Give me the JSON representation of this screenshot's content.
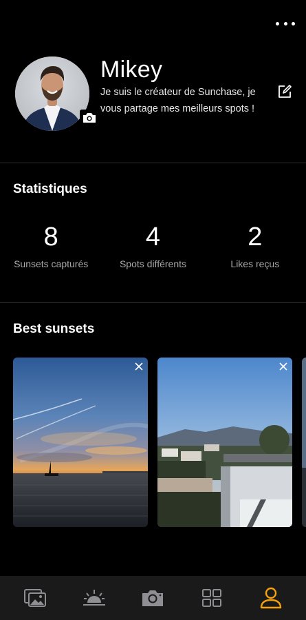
{
  "header": {
    "more_icon": "more-horizontal-icon"
  },
  "profile": {
    "name": "Mikey",
    "bio": "Je suis le créateur de Sunchase, je vous partage mes meilleurs spots !",
    "avatar_icon": "camera-icon",
    "edit_icon": "edit-icon"
  },
  "stats": {
    "title": "Statistiques",
    "items": [
      {
        "value": "8",
        "label": "Sunsets capturés"
      },
      {
        "value": "4",
        "label": "Spots différents"
      },
      {
        "value": "2",
        "label": "Likes reçus"
      }
    ]
  },
  "best_sunsets": {
    "title": "Best sunsets",
    "cards": [
      {
        "icon": "close-icon"
      },
      {
        "icon": "close-icon"
      }
    ]
  },
  "tabbar": {
    "tabs": [
      {
        "icon": "photos-icon",
        "active": false
      },
      {
        "icon": "sunset-icon",
        "active": false
      },
      {
        "icon": "camera-icon",
        "active": false
      },
      {
        "icon": "grid-icon",
        "active": false
      },
      {
        "icon": "profile-icon",
        "active": true
      }
    ],
    "inactive_color": "#8e8e93",
    "active_color": "#f5a20b"
  }
}
